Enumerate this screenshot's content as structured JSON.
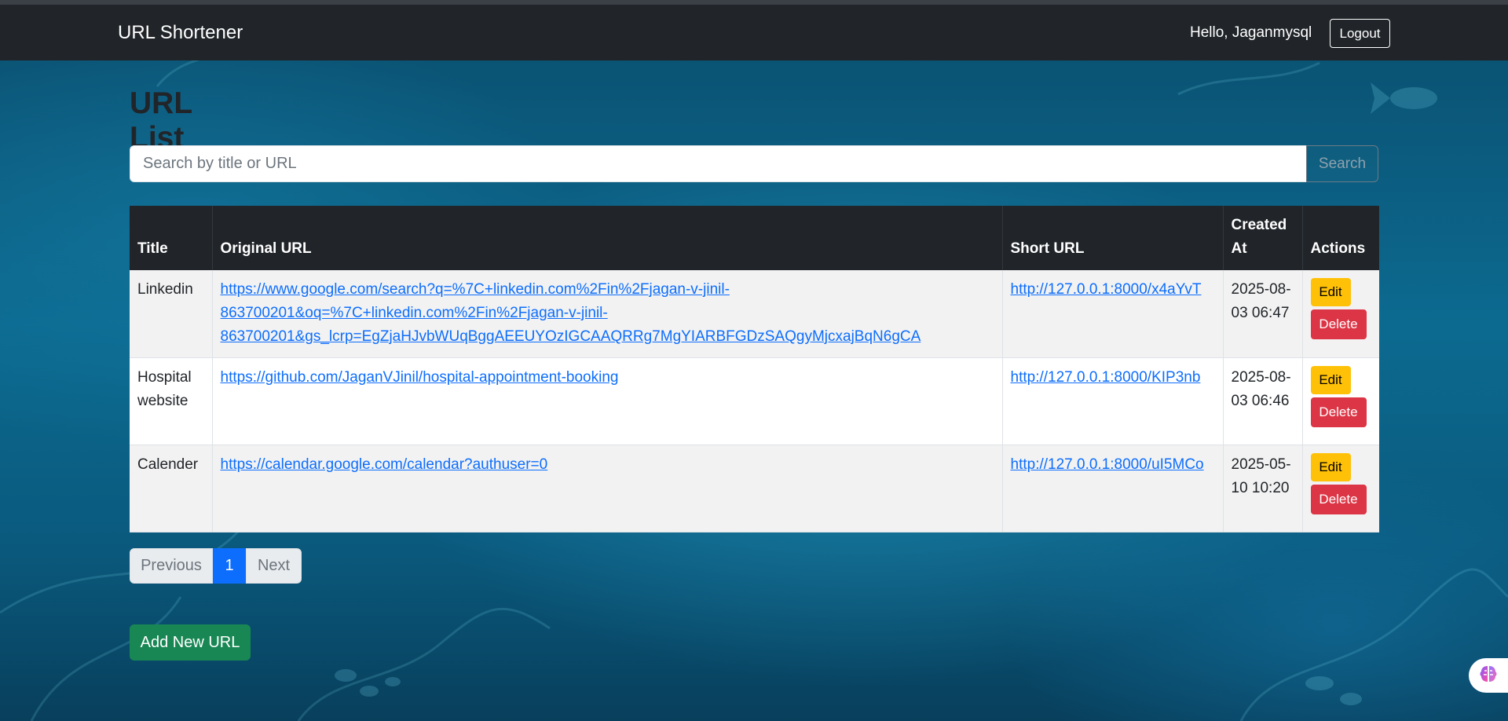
{
  "navbar": {
    "brand": "URL Shortener",
    "greeting": "Hello, Jaganmysql",
    "logout_label": "Logout"
  },
  "main": {
    "title": "URL List",
    "search": {
      "placeholder": "Search by title or URL",
      "value": "",
      "button_label": "Search"
    },
    "table": {
      "headers": [
        "Title",
        "Original URL",
        "Short URL",
        "Created At",
        "Actions"
      ],
      "rows": [
        {
          "title": "Linkedin",
          "original_url": "https://www.google.com/search?q=%7C+linkedin.com%2Fin%2Fjagan-v-jinil-863700201&oq=%7C+linkedin.com%2Fin%2Fjagan-v-jinil-863700201&gs_lcrp=EgZjaHJvbWUqBggAEEUYOzIGCAAQRRg7MgYIARBFGDzSAQgyMjcxajBqN6gCA",
          "short_url": "http://127.0.0.1:8000/x4aYvT",
          "created_at": "2025-08-03 06:47",
          "edit_label": "Edit",
          "delete_label": "Delete"
        },
        {
          "title": "Hospital website",
          "original_url": "https://github.com/JaganVJinil/hospital-appointment-booking",
          "short_url": "http://127.0.0.1:8000/KIP3nb",
          "created_at": "2025-08-03 06:46",
          "edit_label": "Edit",
          "delete_label": "Delete"
        },
        {
          "title": "Calender",
          "original_url": "https://calendar.google.com/calendar?authuser=0",
          "short_url": "http://127.0.0.1:8000/uI5MCo",
          "created_at": "2025-05-10 10:20",
          "edit_label": "Edit",
          "delete_label": "Delete"
        }
      ]
    },
    "pagination": {
      "previous_label": "Previous",
      "current_page": "1",
      "next_label": "Next"
    },
    "add_button_label": "Add New URL"
  },
  "colors": {
    "navbar": "#212529",
    "primary": "#0d6efd",
    "success": "#198754",
    "warning": "#ffc107",
    "danger": "#dc3545",
    "background": "#0b5c7d"
  },
  "icons": {
    "floating_widget": "brain-icon"
  }
}
